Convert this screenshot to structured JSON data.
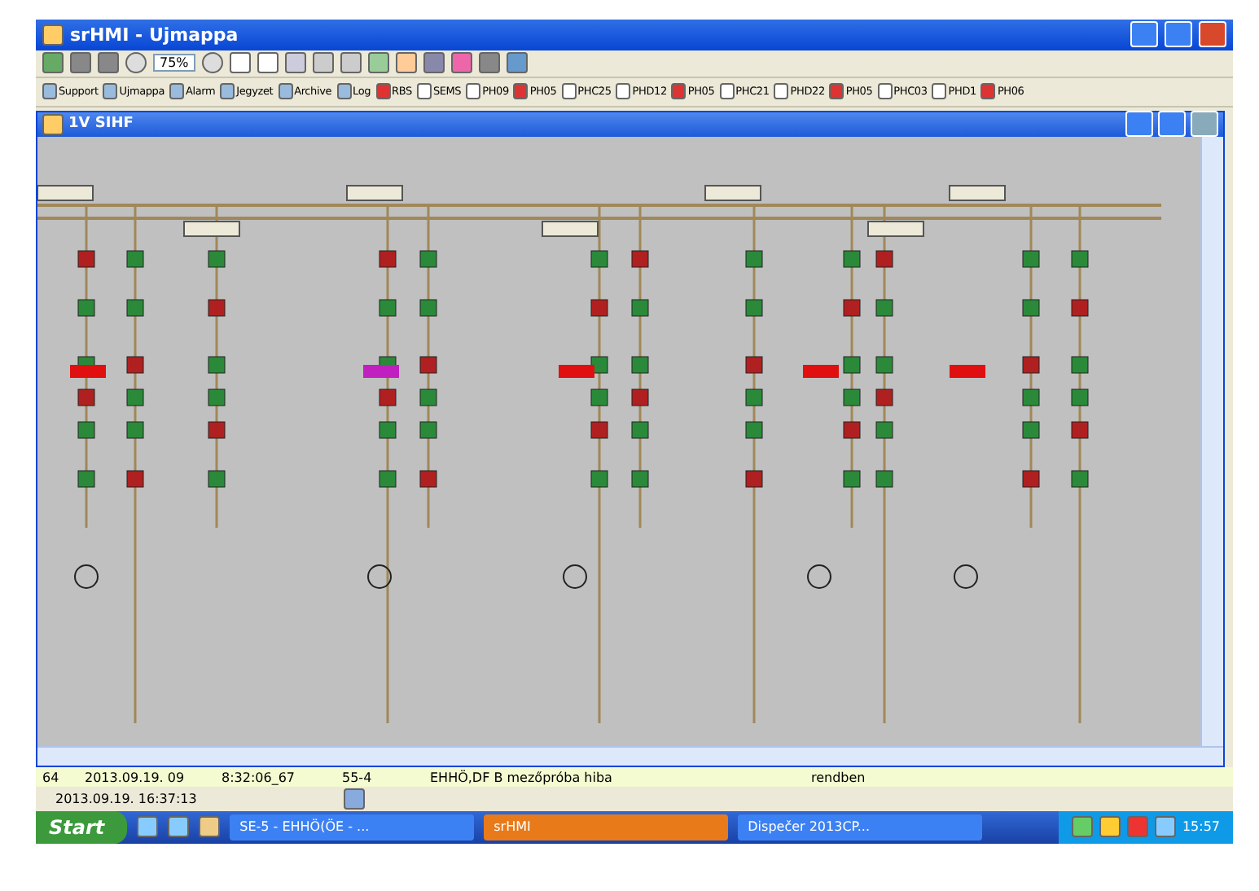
{
  "window": {
    "title": "srHMI - Ujmappa"
  },
  "toolbar": {
    "zoom": "75%"
  },
  "shortcut_bar": [
    {
      "label": "Support"
    },
    {
      "label": "Ujmappa"
    },
    {
      "label": "Alarm"
    },
    {
      "label": "Jegyzet"
    },
    {
      "label": "Archive"
    },
    {
      "label": "Log"
    },
    {
      "label": "RBS"
    },
    {
      "label": "SEMS"
    },
    {
      "label": "PH09"
    },
    {
      "label": "PH05"
    },
    {
      "label": "PHC25"
    },
    {
      "label": "PHD12"
    },
    {
      "label": "PH05"
    },
    {
      "label": "PHC21"
    },
    {
      "label": "PHD22"
    },
    {
      "label": "PH05"
    },
    {
      "label": "PHC03"
    },
    {
      "label": "PHD1"
    },
    {
      "label": "PH06"
    }
  ],
  "diagram_window": {
    "title": "1V SIHF"
  },
  "alarm_row": {
    "cells": [
      "64",
      "2013.09.19. 09",
      "8:32:06_67",
      "55-4",
      "EHHÖ,DF B mezőpróba hiba",
      "rendben"
    ]
  },
  "status_bar": {
    "time": "2013.09.19. 16:37:13"
  },
  "taskbar": {
    "start": "Start",
    "tasks": [
      {
        "label": "SE-5 - EHHÖ(ÖE - ...",
        "selected": false
      },
      {
        "label": "srHMI",
        "selected": true
      },
      {
        "label": "Dispečer 2013CP...",
        "selected": false
      }
    ],
    "clock": "15:57"
  }
}
